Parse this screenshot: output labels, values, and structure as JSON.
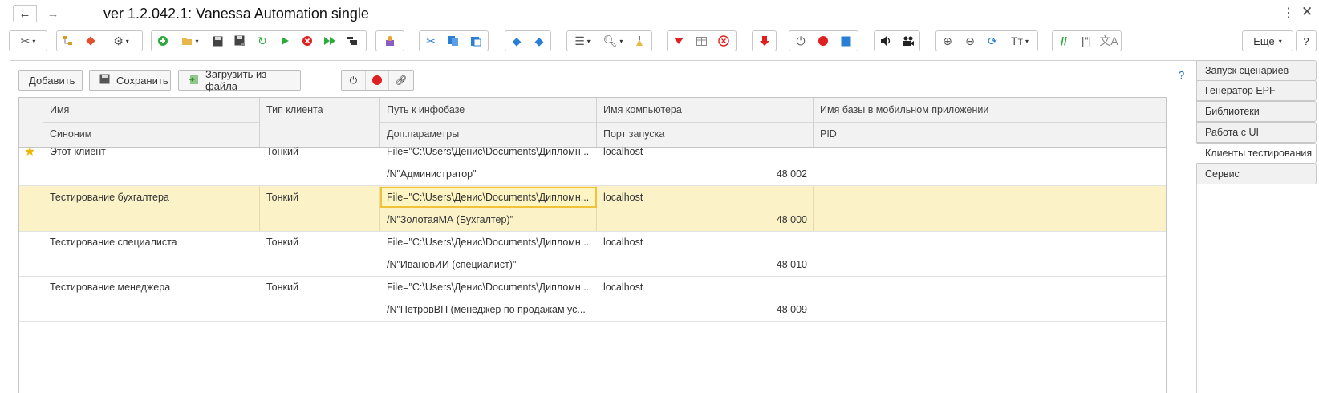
{
  "window": {
    "title": "ver 1.2.042.1: Vanessa Automation single",
    "back_icon": "←",
    "forward_icon": "→",
    "menu_icon": "⋮",
    "close_icon": "✕"
  },
  "toolbar": {
    "more_label": "Еще",
    "help_label": "?",
    "colors": {
      "green": "#2eaa3c",
      "red": "#e02020",
      "blue": "#2a7fd4"
    }
  },
  "form": {
    "add_label": "Добавить",
    "save_label": "Сохранить",
    "load_label": "Загрузить из файла",
    "help_label": "?"
  },
  "table": {
    "headers": {
      "name": "Имя",
      "client_type": "Тип клиента",
      "infobase_path": "Путь к инфобазе",
      "computer_name": "Имя компьютера",
      "mobile_db_name": "Имя базы в мобильном приложении",
      "synonym": "Синоним",
      "extra_params": "Доп.параметры",
      "launch_port": "Порт запуска",
      "pid": "PID"
    },
    "rows": [
      {
        "name": "Этот клиент",
        "client_type": "Тонкий",
        "path": "File=\"C:\\Users\\Денис\\Documents\\Дипломн...",
        "computer": "localhost",
        "params": "/N\"Администратор\"",
        "port": "48 002",
        "starred": true
      },
      {
        "name": "Тестирование бухгалтера",
        "client_type": "Тонкий",
        "path": "File=\"C:\\Users\\Денис\\Documents\\Дипломн...",
        "computer": "localhost",
        "params": "/N\"ЗолотаяМА (Бухгалтер)\"",
        "port": "48 000",
        "selected": true
      },
      {
        "name": "Тестирование специалиста",
        "client_type": "Тонкий",
        "path": "File=\"C:\\Users\\Денис\\Documents\\Дипломн...",
        "computer": "localhost",
        "params": "/N\"ИвановИИ (специалист)\"",
        "port": "48 010"
      },
      {
        "name": "Тестирование менеджера",
        "client_type": "Тонкий",
        "path": "File=\"C:\\Users\\Денис\\Documents\\Дипломн...",
        "computer": "localhost",
        "params": "/N\"ПетровВП (менеджер по продажам ус...",
        "port": "48 009"
      }
    ]
  },
  "side_tabs": [
    {
      "label": "Запуск сценариев",
      "active": false
    },
    {
      "label": "Генератор EPF",
      "active": false
    },
    {
      "label": "Библиотеки",
      "active": false
    },
    {
      "label": "Работа с UI",
      "active": false
    },
    {
      "label": "Клиенты тестирования",
      "active": true
    },
    {
      "label": "Сервис",
      "active": false
    }
  ]
}
